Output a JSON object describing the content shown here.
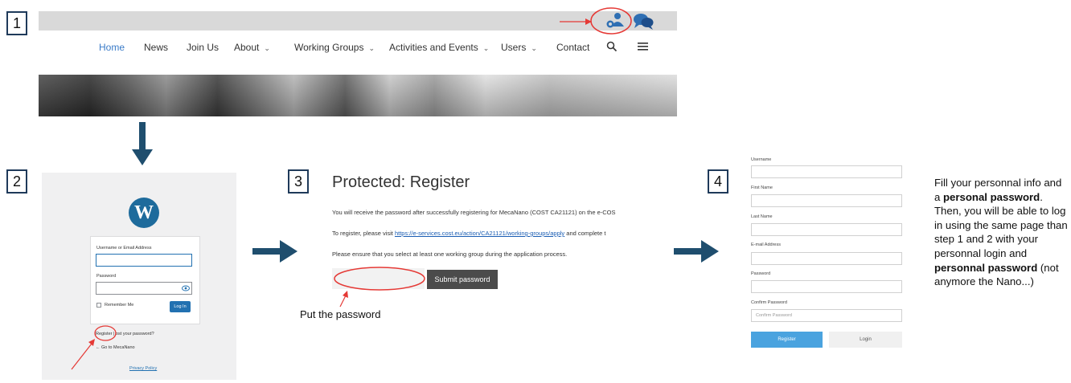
{
  "steps": [
    "1",
    "2",
    "3",
    "4"
  ],
  "nav": {
    "items": [
      "Home",
      "News",
      "Join Us",
      "About",
      "Working Groups",
      "Activities and Events",
      "Users",
      "Contact"
    ],
    "chevron_items": [
      "About",
      "Working Groups",
      "Activities and Events",
      "Users"
    ],
    "active": "Home",
    "icons": [
      "search-icon",
      "hamburger-menu-icon",
      "user-account-icon",
      "chat-icon"
    ]
  },
  "login": {
    "username_label": "Username or Email Address",
    "password_label": "Password",
    "remember_label": "Remember Me",
    "login_button": "Log In",
    "register_link": "Register",
    "separator": "|",
    "lost_password": "Lost your password?",
    "lost_password_visible": "ost your password?",
    "go_to": "← Go to MecaNano",
    "privacy": "Privacy Policy"
  },
  "protected": {
    "title": "Protected: Register",
    "line1": "You will receive the password after successfully registering for MecaNano (COST CA21121) on the e-COS",
    "line2_prefix": "To register, please visit ",
    "line2_link": "https://e-services.cost.eu/action/CA21121/working-groups/apply",
    "line2_suffix": " and complete t",
    "line3": "Please ensure that you select at least one working group during the application process.",
    "submit_button": "Submit password",
    "annotation": "Put the password"
  },
  "register_form": {
    "username_label": "Username",
    "first_name_label": "First Name",
    "last_name_label": "Last Name",
    "email_label": "E-mail Address",
    "password_label": "Password",
    "confirm_label": "Confirm Password",
    "confirm_placeholder": "Confirm Password",
    "register_button": "Register",
    "login_button": "Login"
  },
  "instructions": {
    "t1": "Fill your personnal info and a ",
    "b1": "personal password",
    "t2": ". Then, you will be able to log in using the same page than step 1 and 2 with your personnal login and ",
    "b2": "personnal password",
    "t3": " (not anymore the Nano...)"
  },
  "colors": {
    "accent_blue": "#3a7bc8",
    "arrow_navy": "#1f4e6e",
    "annotation_red": "#e53935",
    "wp_blue": "#2271b1",
    "register_blue": "#4aa3df"
  }
}
